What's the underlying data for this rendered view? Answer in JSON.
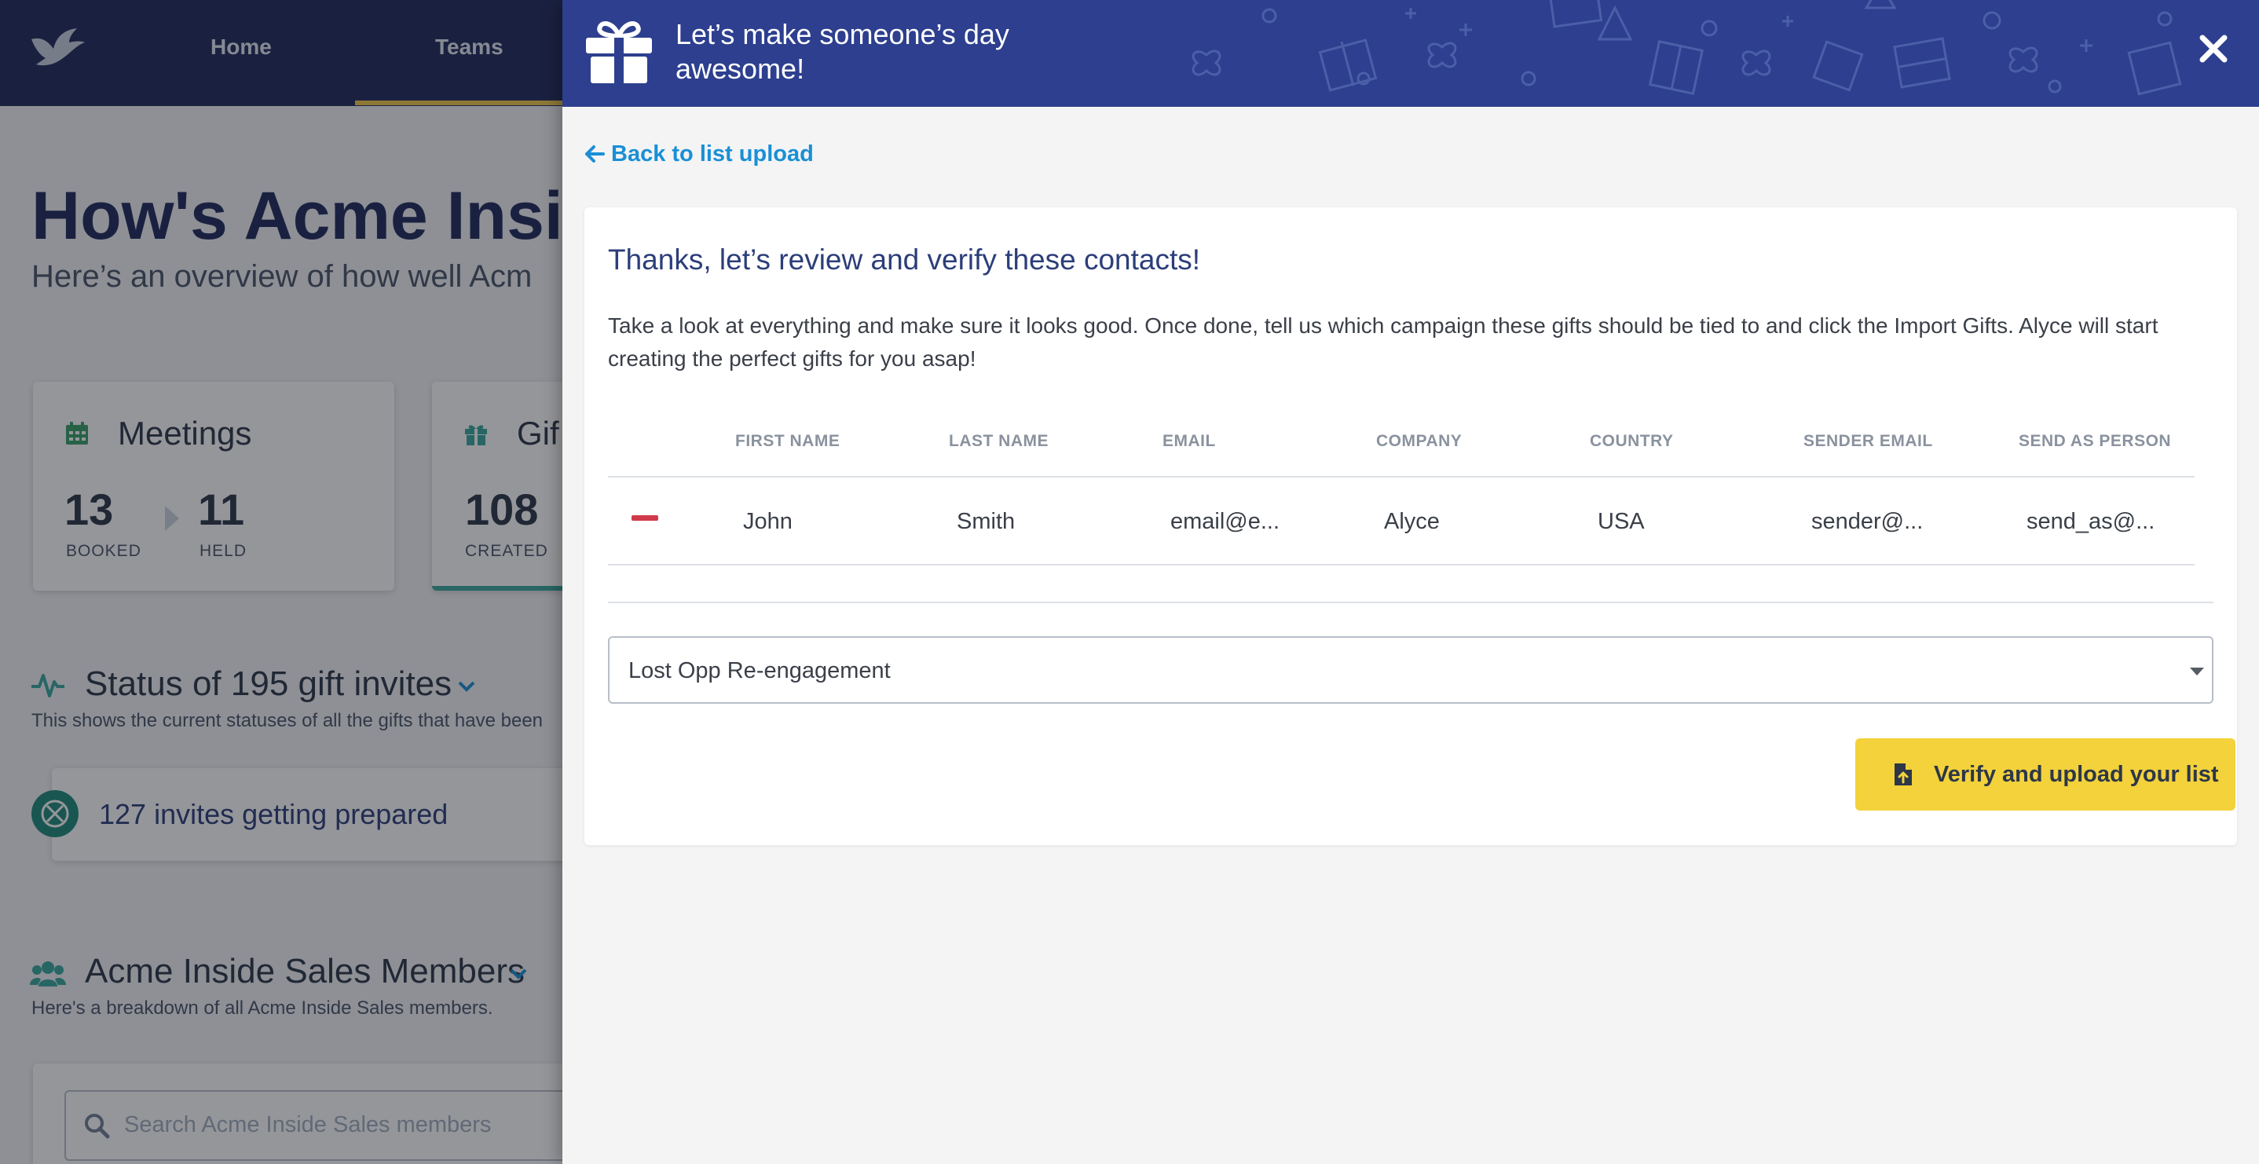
{
  "nav": {
    "home": "Home",
    "teams": "Teams"
  },
  "dashboard": {
    "title": "How's Acme Insid",
    "subtitle": "Here’s an overview of how well Acm",
    "meetings": {
      "heading": "Meetings",
      "booked_value": "13",
      "booked_label": "BOOKED",
      "held_value": "11",
      "held_label": "HELD"
    },
    "gifts": {
      "heading": "Gif",
      "created_value": "108",
      "created_label": "CREATED"
    },
    "status": {
      "heading": "Status of 195 gift invites",
      "subtitle": "This shows the current statuses of all the gifts that have been"
    },
    "preparing": "127 invites getting prepared",
    "members": {
      "heading": "Acme Inside Sales Members",
      "subtitle": "Here's a breakdown of all Acme Inside Sales members.",
      "search_placeholder": "Search Acme Inside Sales members"
    }
  },
  "panel": {
    "header_title": "Let’s make someone’s day awesome!",
    "back_link": "Back to list upload",
    "review_title": "Thanks, let’s review and verify these contacts!",
    "review_description": "Take a look at everything and make sure it looks good. Once done, tell us which campaign these gifts should be tied to and click the Import Gifts. Alyce will start creating the perfect gifts for you asap!",
    "columns": [
      "FIRST NAME",
      "LAST NAME",
      "EMAIL",
      "COMPANY",
      "COUNTRY",
      "SENDER EMAIL",
      "SEND AS PERSON"
    ],
    "rows": [
      [
        "John",
        "Smith",
        "email@e...",
        "Alyce",
        "USA",
        "sender@...",
        "send_as@..."
      ]
    ],
    "campaign_selected": "Lost Opp Re-engagement",
    "verify_button": "Verify and upload your list"
  },
  "colors": {
    "nav_bg": "#1f2a5c",
    "panel_header_bg": "#2d3f8e",
    "accent_yellow": "#f3d23b",
    "link_blue": "#1a8fd6",
    "remove_red": "#d13a4a",
    "teal": "#38a89d"
  },
  "icons": {
    "logo": "dove-logo-icon",
    "gift": "gift-icon",
    "close": "close-icon",
    "back": "arrow-left-icon",
    "remove": "minus-icon",
    "upload": "file-upload-icon",
    "calendar": "calendar-icon",
    "pulse": "pulse-icon",
    "users": "users-icon",
    "search": "search-icon"
  }
}
